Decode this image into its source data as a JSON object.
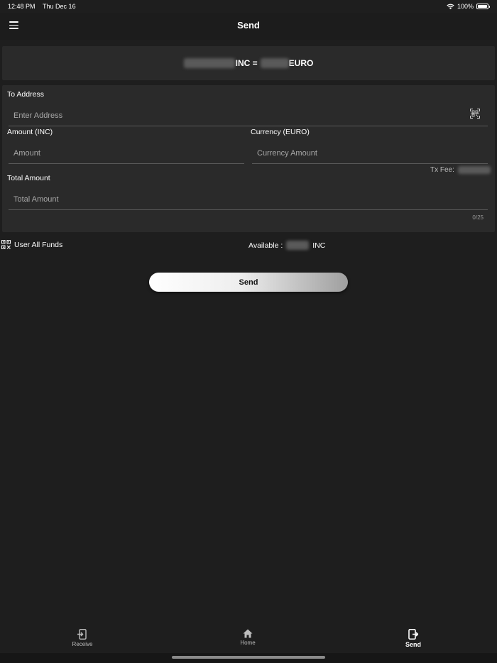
{
  "status_bar": {
    "time": "12:48 PM",
    "date": "Thu Dec 16",
    "battery": "100%"
  },
  "header": {
    "title": "Send"
  },
  "rate": {
    "crypto_unit": "INC =",
    "fiat_unit": "EURO"
  },
  "form": {
    "to_address_label": "To Address",
    "address_placeholder": "Enter Address",
    "amount_label": "Amount (INC)",
    "amount_placeholder": "Amount",
    "currency_label": "Currency (EURO)",
    "currency_placeholder": "Currency Amount",
    "tx_fee_label": "Tx Fee:",
    "total_label": "Total Amount",
    "total_placeholder": "Total Amount",
    "counter": "0/25"
  },
  "funds": {
    "use_all_label": "User All Funds",
    "available_label": "Available :",
    "available_unit": "INC"
  },
  "send_button": {
    "label": "Send"
  },
  "tabs": [
    {
      "label": "Receive",
      "icon": "receive-icon",
      "active": false
    },
    {
      "label": "Home",
      "icon": "home-icon",
      "active": false
    },
    {
      "label": "Send",
      "icon": "send-icon",
      "active": true
    }
  ]
}
